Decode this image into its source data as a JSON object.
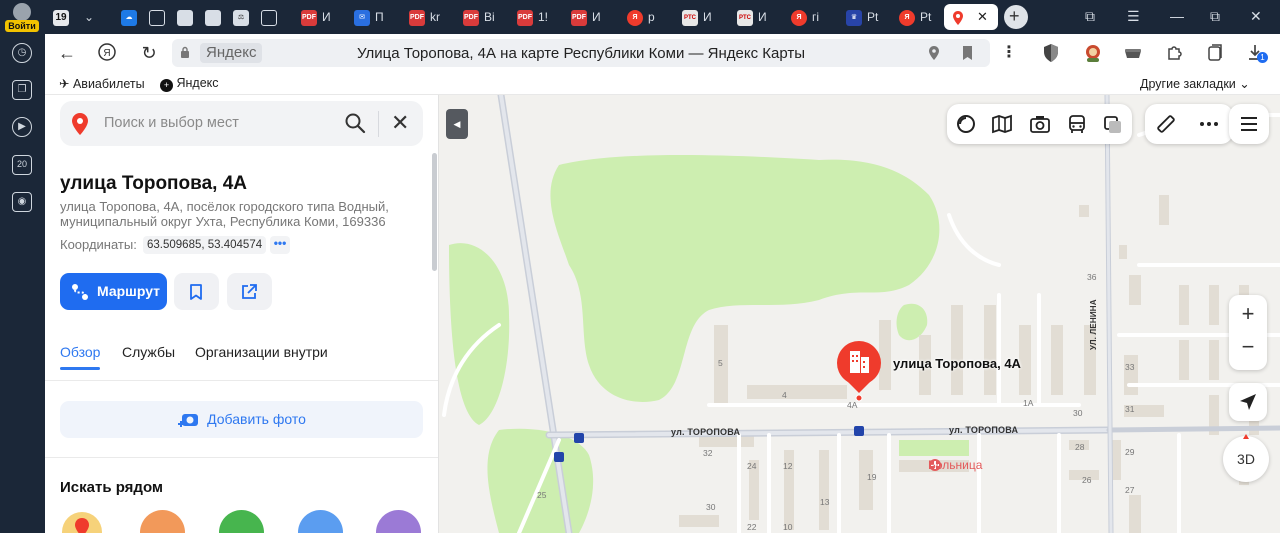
{
  "browser": {
    "login_label": "Войти",
    "tab_count": "19",
    "tabs": [
      {
        "label": "",
        "fav": "cloud"
      },
      {
        "label": "",
        "fav": "doc"
      },
      {
        "label": "",
        "fav": "img"
      },
      {
        "label": "",
        "fav": "img"
      },
      {
        "label": "",
        "fav": "scale"
      },
      {
        "label": "",
        "fav": "doc"
      },
      {
        "label": "И",
        "fav": "PDF"
      },
      {
        "label": "П",
        "fav": "mail"
      },
      {
        "label": "kr",
        "fav": "PDF"
      },
      {
        "label": "Ві",
        "fav": "PDF"
      },
      {
        "label": "1!",
        "fav": "PDF"
      },
      {
        "label": "И",
        "fav": "PDF"
      },
      {
        "label": "р",
        "fav": "Я"
      },
      {
        "label": "И",
        "fav": "РТС"
      },
      {
        "label": "И",
        "fav": "РТС"
      },
      {
        "label": "гі",
        "fav": "Я"
      },
      {
        "label": "Pt",
        "fav": "crest"
      },
      {
        "label": "Pt",
        "fav": "Я"
      }
    ],
    "active_tab_close": "✕",
    "new_tab": "+",
    "window_controls": [
      "—",
      "⧉",
      "✕"
    ],
    "downloads_badge": "1"
  },
  "address_bar": {
    "host": "Яндекс",
    "page_title": "Улица Торопова, 4А на карте Республики Коми — Яндекс Карты"
  },
  "bookmarks": {
    "items": [
      "Авиабилеты",
      "Яндекс"
    ],
    "other": "Другие закладки"
  },
  "sidebar": {
    "search_placeholder": "Поиск и выбор мест",
    "place": {
      "title": "улица Торопова, 4А",
      "address": "улица Торопова, 4А, посёлок городского типа Водный, муниципальный округ Ухта, Республика Коми, 169336",
      "coords_label": "Координаты:",
      "coords_value": "63.509685, 53.404574",
      "coords_more": "•••"
    },
    "route_button": "Маршрут",
    "tabs": [
      "Обзор",
      "Службы",
      "Организации внутри"
    ],
    "add_photo": "Добавить фото",
    "nearby_title": "Искать рядом"
  },
  "map": {
    "marker_label": "улица Торопова, 4А",
    "hospital_label": "Больница",
    "streets": [
      "ул. ТОРОПОВА",
      "ул. ТОРОПОВА",
      "УЛ. ЛЕНИНА"
    ],
    "building_numbers": [
      "36",
      "5",
      "4",
      "4А",
      "1А",
      "30",
      "33",
      "31",
      "32",
      "24",
      "12",
      "19",
      "28",
      "29",
      "26",
      "27",
      "25",
      "30",
      "13",
      "22",
      "10"
    ],
    "bus_stop": "Я",
    "zoom_in": "+",
    "zoom_out": "−",
    "btn_3d": "3D"
  },
  "colors": {
    "accent": "#1f6cf0",
    "marker": "#ef3b2c",
    "forest": "#cdeeb0",
    "road": "#d3d8e2"
  }
}
